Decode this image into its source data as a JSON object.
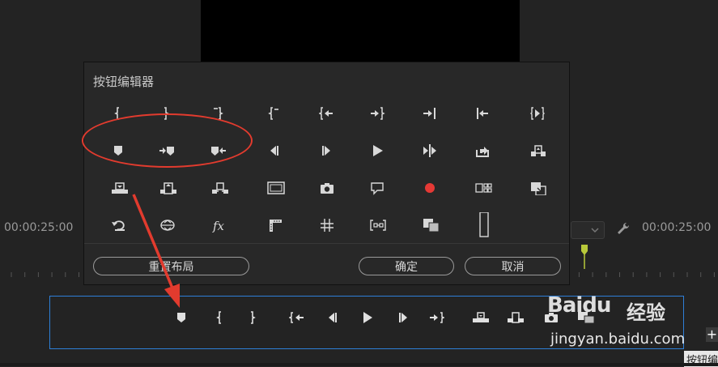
{
  "timeline": {
    "timecode_left": "00:00:25:00",
    "timecode_right": "00:00:25:00"
  },
  "dialog": {
    "title": "按钮编辑器",
    "reset_label": "重置布局",
    "ok_label": "确定",
    "cancel_label": "取消",
    "buttons": [
      {
        "row": 0,
        "icon": "mark-in-icon"
      },
      {
        "row": 0,
        "icon": "mark-out-icon"
      },
      {
        "row": 0,
        "icon": "mark-clip-icon"
      },
      {
        "row": 0,
        "icon": "clear-in-icon"
      },
      {
        "row": 0,
        "icon": "go-to-in-icon"
      },
      {
        "row": 0,
        "icon": "go-to-out-icon"
      },
      {
        "row": 0,
        "icon": "go-to-next-edit-icon"
      },
      {
        "row": 0,
        "icon": "go-to-previous-edit-icon"
      },
      {
        "row": 0,
        "icon": "play-in-to-out-icon"
      },
      {
        "row": 1,
        "icon": "add-marker-icon"
      },
      {
        "row": 1,
        "icon": "go-to-next-marker-icon"
      },
      {
        "row": 1,
        "icon": "go-to-previous-marker-icon"
      },
      {
        "row": 1,
        "icon": "step-back-icon"
      },
      {
        "row": 1,
        "icon": "step-forward-icon"
      },
      {
        "row": 1,
        "icon": "play-icon"
      },
      {
        "row": 1,
        "icon": "play-around-icon"
      },
      {
        "row": 1,
        "icon": "export-frame-icon"
      },
      {
        "row": 1,
        "icon": "lift-icon"
      },
      {
        "row": 2,
        "icon": "insert-icon"
      },
      {
        "row": 2,
        "icon": "overwrite-icon"
      },
      {
        "row": 2,
        "icon": "extract-icon"
      },
      {
        "row": 2,
        "icon": "safe-margins-icon"
      },
      {
        "row": 2,
        "icon": "camera-icon"
      },
      {
        "row": 2,
        "icon": "comment-icon"
      },
      {
        "row": 2,
        "icon": "record-icon"
      },
      {
        "row": 2,
        "icon": "multi-camera-icon"
      },
      {
        "row": 2,
        "icon": "comparison-view-icon"
      },
      {
        "row": 3,
        "icon": "loop-icon"
      },
      {
        "row": 3,
        "icon": "vr-video-icon"
      },
      {
        "row": 3,
        "icon": "fx-icon"
      },
      {
        "row": 3,
        "icon": "show-rulers-icon"
      },
      {
        "row": 3,
        "icon": "show-guides-icon"
      },
      {
        "row": 3,
        "icon": "snap-in-program-monitor-icon"
      },
      {
        "row": 3,
        "icon": "toggle-proxies-icon"
      },
      {
        "row": 3,
        "icon": "spacer-icon"
      }
    ]
  },
  "transport_bar": {
    "buttons": [
      "add-marker-icon",
      "mark-in-icon",
      "mark-out-icon",
      "go-to-in-icon",
      "step-back-icon",
      "play-icon",
      "step-forward-icon",
      "go-to-out-icon",
      "insert-icon",
      "overwrite-icon",
      "camera-icon",
      "toggle-proxies-icon"
    ]
  },
  "tooltip_text": "按钮编",
  "watermark": {
    "logo": "Baidu",
    "logo_cn": "经验",
    "url": "jingyan.baidu.com"
  },
  "colors": {
    "annotation_red": "#e23b2e",
    "selection_blue": "#2e7fd8",
    "record_red": "#e53935"
  }
}
